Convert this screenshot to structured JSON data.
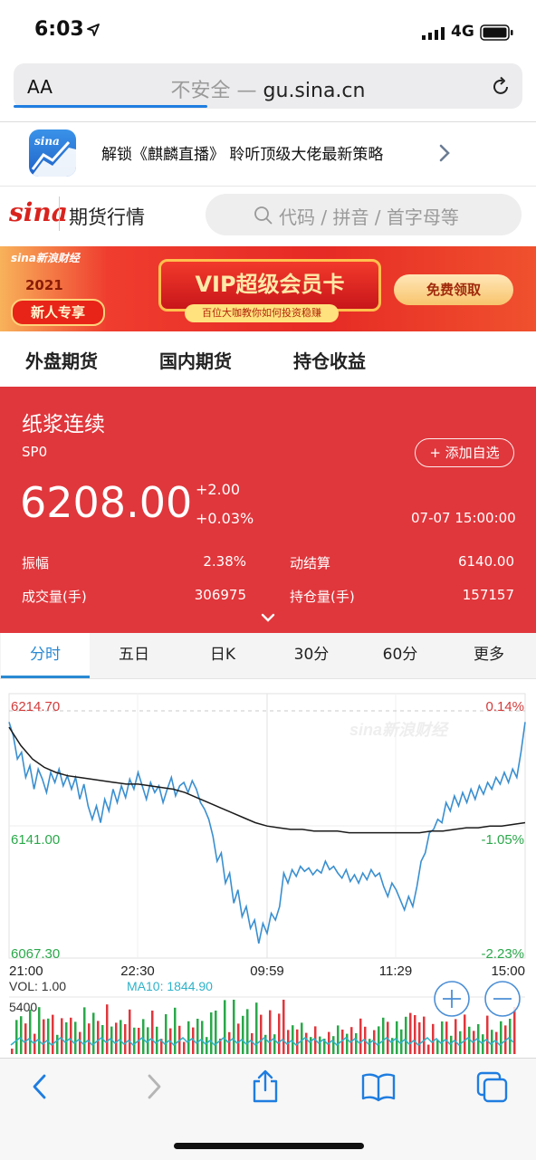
{
  "status_bar": {
    "time": "6:03",
    "network": "4G"
  },
  "address_bar": {
    "text_size_label": "AA",
    "security_label": "不安全",
    "separator": " — ",
    "domain": "gu.sina.cn",
    "load_progress_percent": 38
  },
  "app_banner": {
    "text": "解锁《麒麟直播》 聆听顶级大佬最新策略"
  },
  "header": {
    "logo": "sina",
    "title": "期货行情",
    "search_placeholder": "代码 / 拼音 / 首字母等"
  },
  "ad_banner": {
    "logo_text": "sina新浪财经",
    "year": "2021",
    "badge": "新人专享",
    "title": "VIP超级会员卡",
    "subtitle": "百位大咖教你如何投资稳赚",
    "button": "免费领取"
  },
  "category_tabs": [
    "外盘期货",
    "国内期货",
    "持仓收益"
  ],
  "quote": {
    "name": "纸浆连续",
    "code": "SP0",
    "add_watchlist": "+ 添加自选",
    "price": "6208.00",
    "change": "+2.00",
    "change_pct": "+0.03%",
    "datetime": "07-07 15:00:00",
    "stats": [
      {
        "label": "振幅",
        "value": "2.38%"
      },
      {
        "label": "动结算",
        "value": "6140.00"
      },
      {
        "label": "成交量(手)",
        "value": "306975"
      },
      {
        "label": "持仓量(手)",
        "value": "157157"
      }
    ]
  },
  "period_tabs": [
    "分时",
    "五日",
    "日K",
    "30分",
    "60分",
    "更多"
  ],
  "active_period": 0,
  "chart_data": {
    "type": "line",
    "watermark": "sina新浪财经",
    "price_axis": {
      "max": "6214.70",
      "mid": "6141.00",
      "min": "6067.30",
      "ylim": [
        6067.3,
        6214.7
      ]
    },
    "pct_axis": {
      "max": "0.14%",
      "mid": "-1.05%",
      "min": "-2.23%"
    },
    "time_ticks": [
      "21:00",
      "22:30",
      "09:59",
      "11:29",
      "15:00"
    ],
    "colors": {
      "price": "#3a8fd0",
      "average": "#1a1a1a",
      "up": "#e0373c",
      "down": "#2aa84a",
      "volume_ma": "#2fb2c8"
    },
    "series": [
      {
        "values": [
          6208,
          6200,
          6186,
          6190,
          6175,
          6182,
          6168,
          6180,
          6174,
          6166,
          6178,
          6172,
          6180,
          6170,
          6176,
          6168,
          6175,
          6162,
          6171,
          6158,
          6150,
          6158,
          6148,
          6162,
          6155,
          6168,
          6160,
          6170,
          6163,
          6174,
          6168,
          6178,
          6170,
          6162,
          6172,
          6166,
          6170,
          6160,
          6168,
          6175,
          6164,
          6170,
          6172,
          6166,
          6173,
          6168,
          6160,
          6156,
          6150,
          6140,
          6125,
          6130,
          6112,
          6118,
          6100,
          6108,
          6092,
          6098,
          6085,
          6090,
          6076,
          6088,
          6082,
          6094,
          6090,
          6098,
          6118,
          6112,
          6120,
          6116,
          6122,
          6119,
          6121,
          6117,
          6120,
          6118,
          6125,
          6120,
          6122,
          6118,
          6115,
          6120,
          6113,
          6117,
          6112,
          6118,
          6114,
          6120,
          6116,
          6118,
          6110,
          6104,
          6112,
          6108,
          6102,
          6096,
          6104,
          6098,
          6110,
          6125,
          6130,
          6142,
          6144,
          6150,
          6148,
          6160,
          6155,
          6164,
          6158,
          6166,
          6160,
          6168,
          6162,
          6170,
          6165,
          6172,
          6168,
          6175,
          6171,
          6178,
          6172,
          6180,
          6175,
          6190,
          6208
        ]
      },
      {
        "values": [
          6205,
          6194,
          6186,
          6181,
          6178,
          6176,
          6175,
          6174,
          6173,
          6172,
          6171,
          6171,
          6170,
          6169,
          6168,
          6166,
          6163,
          6160,
          6157,
          6154,
          6151,
          6148,
          6146,
          6145,
          6144,
          6144,
          6143,
          6143,
          6143,
          6142,
          6142,
          6142,
          6142,
          6142,
          6142,
          6142,
          6143,
          6143,
          6144,
          6145,
          6145,
          6146,
          6146,
          6147,
          6148
        ]
      }
    ],
    "volume": {
      "vol_label": "VOL: 1.00",
      "ma_label": "MA10: 1844.90",
      "max_label": "5400"
    }
  },
  "toolbar": [
    "back",
    "forward",
    "share",
    "bookmarks",
    "tabs"
  ]
}
